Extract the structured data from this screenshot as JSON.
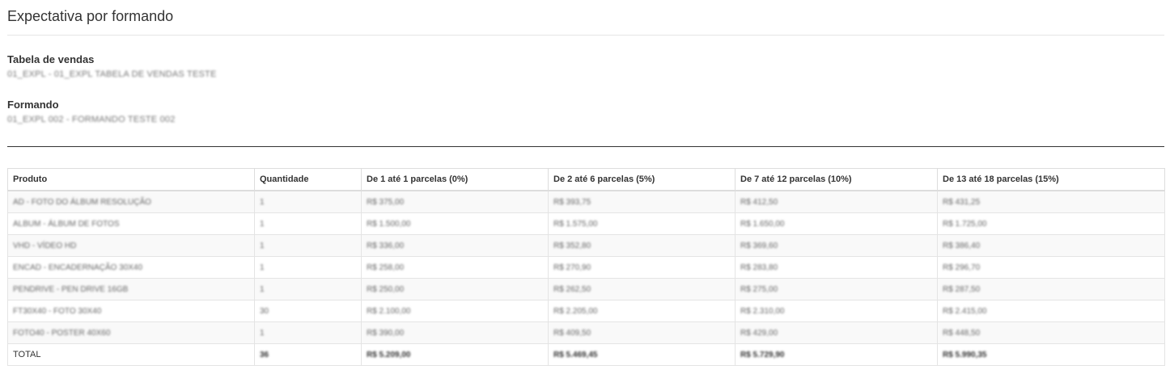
{
  "page": {
    "title": "Expectativa por formando"
  },
  "fields": {
    "sales_table": {
      "label": "Tabela de vendas",
      "value": "01_EXPL - 01_EXPL TABELA DE VENDAS TESTE"
    },
    "student": {
      "label": "Formando",
      "value": "01_EXPL 002 - FORMANDO TESTE 002"
    }
  },
  "table": {
    "headers": [
      "Produto",
      "Quantidade",
      "De 1 até 1 parcelas (0%)",
      "De 2 até 6 parcelas (5%)",
      "De 7 até 12 parcelas (10%)",
      "De 13 até 18 parcelas (15%)"
    ],
    "rows": [
      [
        "AD - FOTO DO ÁLBUM RESOLUÇÃO",
        "1",
        "R$ 375,00",
        "R$ 393,75",
        "R$ 412,50",
        "R$ 431,25"
      ],
      [
        "ALBUM - ÁLBUM DE FOTOS",
        "1",
        "R$ 1.500,00",
        "R$ 1.575,00",
        "R$ 1.650,00",
        "R$ 1.725,00"
      ],
      [
        "VHD - VÍDEO HD",
        "1",
        "R$ 336,00",
        "R$ 352,80",
        "R$ 369,60",
        "R$ 386,40"
      ],
      [
        "ENCAD - ENCADERNAÇÃO 30X40",
        "1",
        "R$ 258,00",
        "R$ 270,90",
        "R$ 283,80",
        "R$ 296,70"
      ],
      [
        "PENDRIVE - PEN DRIVE 16GB",
        "1",
        "R$ 250,00",
        "R$ 262,50",
        "R$ 275,00",
        "R$ 287,50"
      ],
      [
        "FT30X40 - FOTO 30X40",
        "30",
        "R$ 2.100,00",
        "R$ 2.205,00",
        "R$ 2.310,00",
        "R$ 2.415,00"
      ],
      [
        "FOTO40 - POSTER 40X60",
        "1",
        "R$ 390,00",
        "R$ 409,50",
        "R$ 429,00",
        "R$ 448,50"
      ]
    ],
    "total": {
      "label": "TOTAL",
      "values": [
        "36",
        "R$ 5.209,00",
        "R$ 5.469,45",
        "R$ 5.729,90",
        "R$ 5.990,35"
      ]
    }
  }
}
